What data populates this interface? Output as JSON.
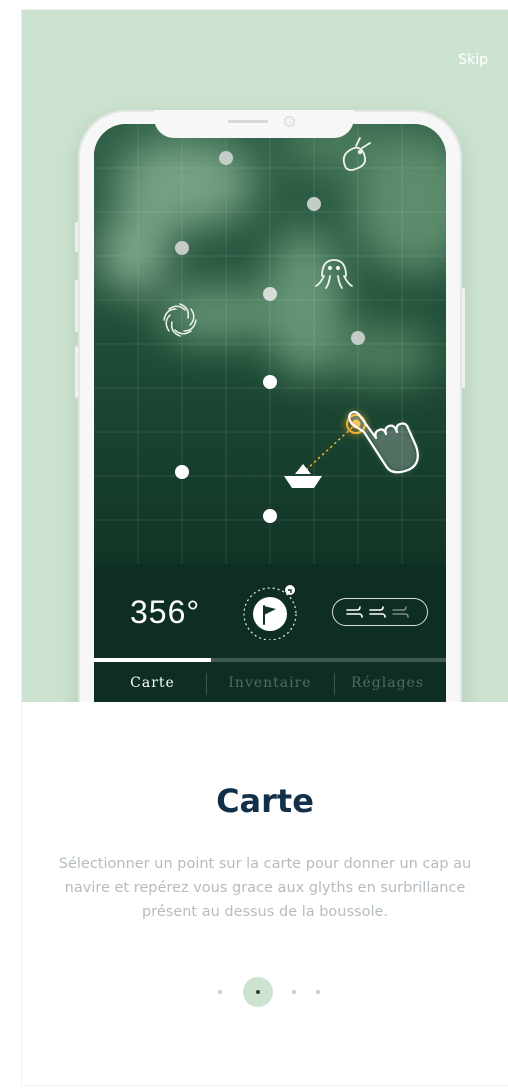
{
  "header": {
    "skip_label": "Skip"
  },
  "phone": {
    "heading_value": "356°",
    "tabs": [
      {
        "label": "Carte",
        "active": true
      },
      {
        "label": "Inventaire",
        "active": false
      },
      {
        "label": "Réglages",
        "active": false
      }
    ]
  },
  "content": {
    "title": "Carte",
    "description": "Sélectionner un point sur la carte pour donner un cap au navire et repérez vous grace aux glyths en surbrillance présent au dessus de la boussole."
  },
  "pagination": {
    "count": 4,
    "active_index": 1
  },
  "colors": {
    "hero_bg": "#cde3d1",
    "map_dark": "#0f2e23",
    "target_accent": "#f4b12a",
    "title_color": "#123049",
    "text_muted": "#b4bcc1"
  },
  "icons": [
    "serpent-icon",
    "octopus-icon",
    "vortex-icon",
    "boat-icon",
    "hand-pointer-icon",
    "flag-icon",
    "wind-icon"
  ]
}
